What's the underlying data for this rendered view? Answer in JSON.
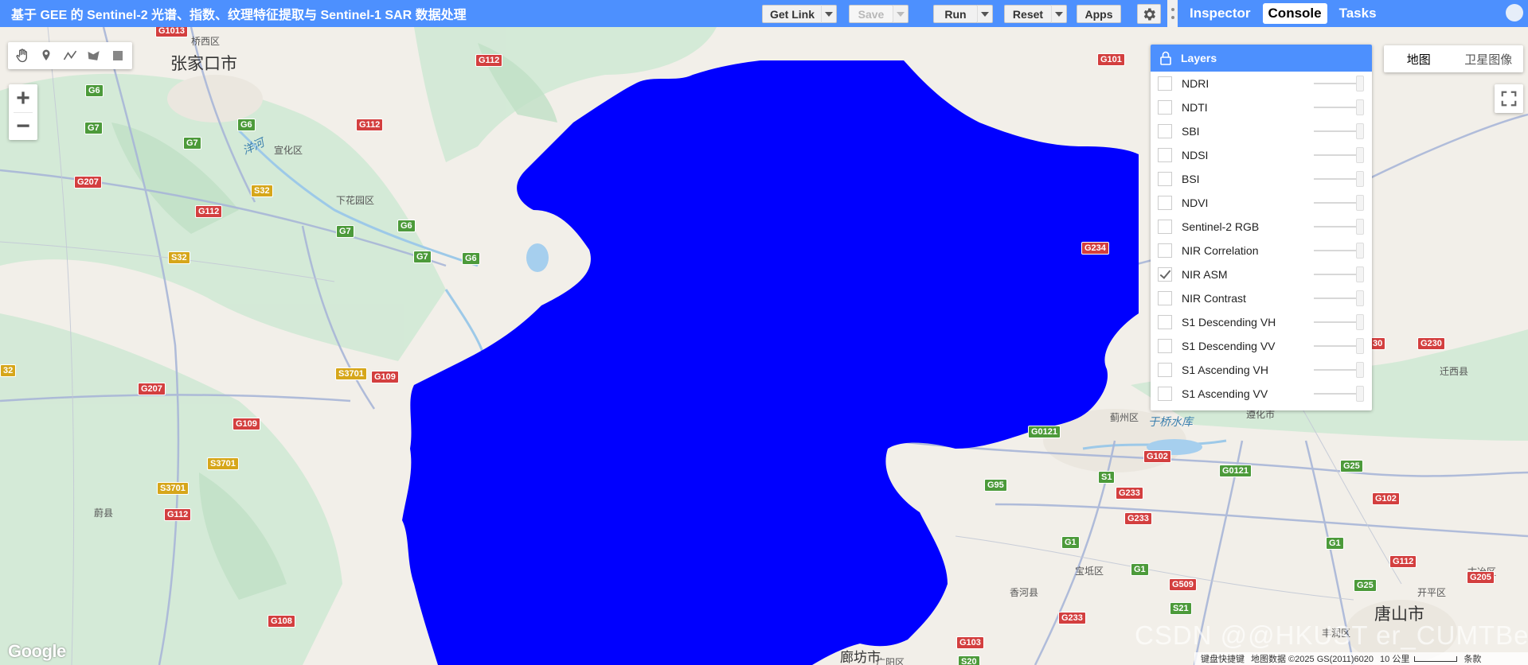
{
  "header": {
    "script_title": "基于 GEE 的 Sentinel-2 光谱、指数、纹理特征提取与 Sentinel-1 SAR 数据处理",
    "get_link_label": "Get Link",
    "save_label": "Save",
    "run_label": "Run",
    "reset_label": "Reset",
    "apps_label": "Apps"
  },
  "right_panel": {
    "tabs": [
      {
        "label": "Inspector",
        "active": false
      },
      {
        "label": "Console",
        "active": true
      },
      {
        "label": "Tasks",
        "active": false
      }
    ]
  },
  "map": {
    "region_fill_color": "#0000ff",
    "map_type": {
      "map_label": "地图",
      "satellite_label": "卫星图像",
      "selected": "地图"
    },
    "layers_panel": {
      "title": "Layers",
      "layers": [
        {
          "name": "NDRI",
          "checked": false
        },
        {
          "name": "NDTI",
          "checked": false
        },
        {
          "name": "SBI",
          "checked": false
        },
        {
          "name": "NDSI",
          "checked": false
        },
        {
          "name": "BSI",
          "checked": false
        },
        {
          "name": "NDVI",
          "checked": false
        },
        {
          "name": "Sentinel-2 RGB",
          "checked": false
        },
        {
          "name": "NIR Correlation",
          "checked": false
        },
        {
          "name": "NIR ASM",
          "checked": true
        },
        {
          "name": "NIR Contrast",
          "checked": false
        },
        {
          "name": "S1 Descending VH",
          "checked": false
        },
        {
          "name": "S1 Descending VV",
          "checked": false
        },
        {
          "name": "S1 Ascending VH",
          "checked": false
        },
        {
          "name": "S1 Ascending VV",
          "checked": false
        }
      ]
    },
    "zoom": {
      "in_label": "+",
      "out_label": "−"
    },
    "city_labels": {
      "zhangjiakou": "张家口市",
      "tangshan": "唐山市",
      "langfang": "廊坊市"
    },
    "place_labels": {
      "qiaoxi": "桥西区",
      "xuanhua": "宣化区",
      "xiahuayuan": "下花园区",
      "yuxian": "蔚县",
      "jizhou": "蓟州区",
      "zunhua": "遵化市",
      "qianxi": "迁西县",
      "baodi": "宝坻区",
      "xianghe": "香河县",
      "fengrun": "丰润区",
      "kaiping": "开平区",
      "guye": "古冶区",
      "guangyang": "广阳区",
      "yanghe": "洋河",
      "yuqiao": "于桥水库",
      "tiaoshi": "条款"
    },
    "shields": [
      "G1013",
      "G112",
      "G101",
      "G6",
      "G7",
      "G6",
      "G112",
      "G7",
      "G207",
      "S32",
      "G112",
      "G7",
      "G6",
      "G7",
      "G6",
      "S32",
      "G234",
      "S3701",
      "G109",
      "G207",
      "G109",
      "S3701",
      "S3701",
      "G112",
      "G108",
      "G0121",
      "G102",
      "S1",
      "G233",
      "G233",
      "G95",
      "G0121",
      "G1",
      "G1",
      "G509",
      "S21",
      "G233",
      "G103",
      "S20",
      "G25",
      "G102",
      "G1",
      "G112",
      "G25",
      "G205",
      "G230",
      "30",
      "32"
    ],
    "attribution": {
      "shortcuts": "键盘快捷键",
      "data": "地图数据 ©2025 GS(2011)6020",
      "scale": "10 公里",
      "terms": "条款"
    },
    "google_logo": "Google",
    "watermark": "CSDN @@HKUST er_CUMTBer"
  }
}
